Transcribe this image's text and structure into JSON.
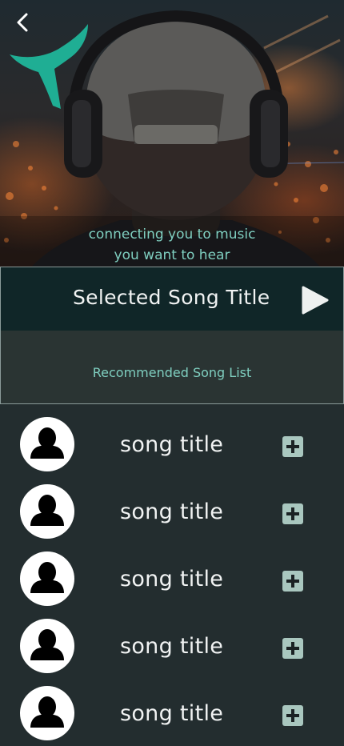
{
  "hero": {
    "tagline_line1": "connecting you to music",
    "tagline_line2": "you want to hear",
    "back_icon": "chevron-left-icon",
    "logo_icon": "t-logo-icon"
  },
  "now_playing": {
    "title": "Selected Song Title",
    "play_icon": "play-icon"
  },
  "recommended": {
    "title": "Recommended Song List"
  },
  "songs": [
    {
      "title": "song title"
    },
    {
      "title": "song title"
    },
    {
      "title": "song title"
    },
    {
      "title": "song title"
    },
    {
      "title": "song title"
    }
  ],
  "colors": {
    "accent": "#7fcfc0",
    "logo": "#1fae94",
    "background": "#232d2f",
    "now_playing_bg": "#102628",
    "add_button": "#a9c7bf"
  }
}
